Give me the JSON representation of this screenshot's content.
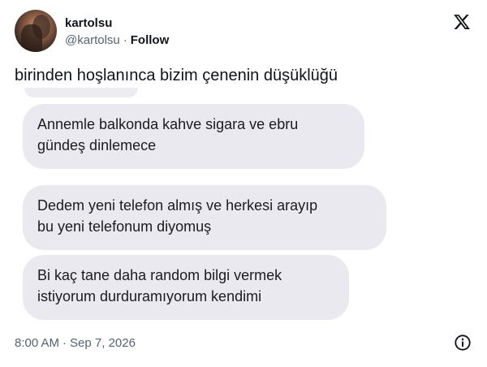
{
  "author": {
    "display_name": "kartolsu",
    "handle": "@kartolsu",
    "separator": "·",
    "follow_label": "Follow"
  },
  "brand": {
    "icon": "x-logo-icon",
    "color": "#0f1419"
  },
  "tweet": {
    "text": "birinden hoşlanınca bizim çenenin düşüklüğü",
    "bubbles": [
      {
        "lines": [
          "Annemle balkonda kahve sigara ve ebru",
          "gündeş dinlemece"
        ]
      },
      {
        "lines": [
          "Dedem yeni telefon almış ve herkesi arayıp",
          "bu yeni telefonum diyomuş"
        ]
      },
      {
        "lines": [
          "Bi kaç tane daha random bilgi vermek",
          "istiyorum durduramıyorum kendimi"
        ]
      }
    ],
    "time": "8:00 AM",
    "separator": "·",
    "date": "Sep 7, 2026"
  },
  "info_icon": "info-icon",
  "colors": {
    "text_primary": "#0f1419",
    "text_secondary": "#536471",
    "bubble_background": "#e9e9ef"
  }
}
